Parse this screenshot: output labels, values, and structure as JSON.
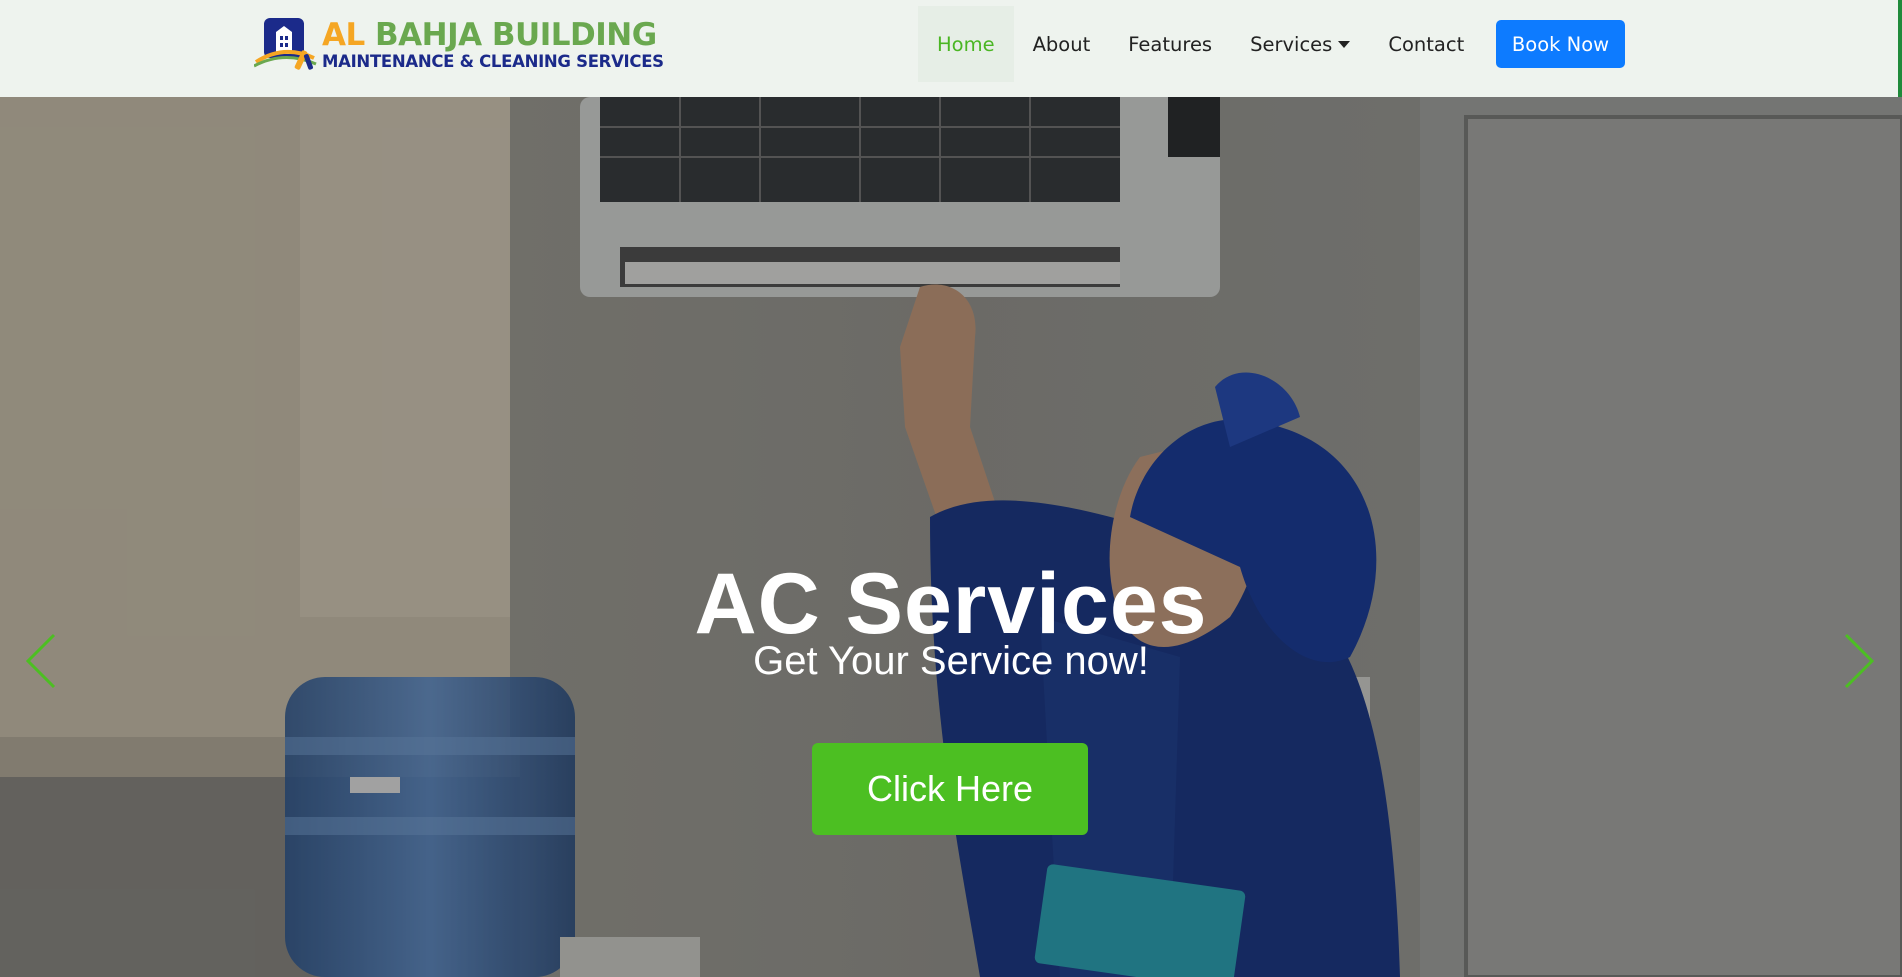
{
  "brand": {
    "name_part1": "AL",
    "name_part2": "BAHJA BUILDING",
    "tagline": "MAINTENANCE & CLEANING SERVICES"
  },
  "nav": {
    "items": [
      {
        "label": "Home",
        "active": true
      },
      {
        "label": "About"
      },
      {
        "label": "Features"
      },
      {
        "label": "Services",
        "dropdown": true
      },
      {
        "label": "Contact"
      }
    ],
    "cta_label": "Book Now"
  },
  "hero": {
    "title": "AC Services",
    "subtitle": "Get Your Service now!",
    "button_label": "Click Here",
    "prev_icon": "chevron-left-icon",
    "next_icon": "chevron-right-icon"
  },
  "colors": {
    "accent_green": "#4cbf22",
    "cta_blue": "#0d7bff",
    "logo_orange": "#f5a623",
    "logo_green": "#6aa84f",
    "logo_navy": "#1b2a8a"
  }
}
